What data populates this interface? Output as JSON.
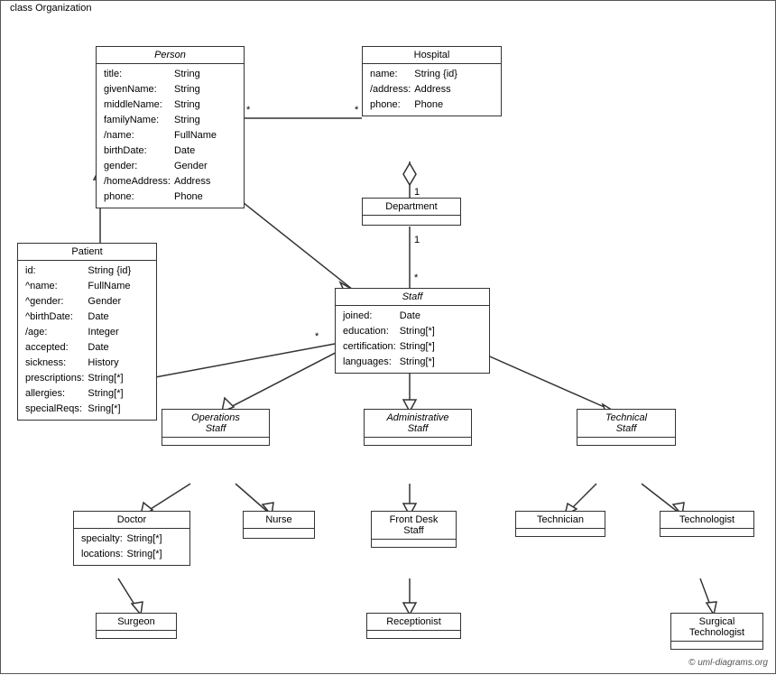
{
  "diagram": {
    "title": "class Organization",
    "copyright": "© uml-diagrams.org",
    "classes": {
      "person": {
        "name": "Person",
        "italic": true,
        "fields": [
          [
            "title:",
            "String"
          ],
          [
            "givenName:",
            "String"
          ],
          [
            "middleName:",
            "String"
          ],
          [
            "familyName:",
            "String"
          ],
          [
            "/name:",
            "FullName"
          ],
          [
            "birthDate:",
            "Date"
          ],
          [
            "gender:",
            "Gender"
          ],
          [
            "/homeAddress:",
            "Address"
          ],
          [
            "phone:",
            "Phone"
          ]
        ]
      },
      "hospital": {
        "name": "Hospital",
        "italic": false,
        "fields": [
          [
            "name:",
            "String {id}"
          ],
          [
            "/address:",
            "Address"
          ],
          [
            "phone:",
            "Phone"
          ]
        ]
      },
      "patient": {
        "name": "Patient",
        "italic": false,
        "fields": [
          [
            "id:",
            "String {id}"
          ],
          [
            "^name:",
            "FullName"
          ],
          [
            "^gender:",
            "Gender"
          ],
          [
            "^birthDate:",
            "Date"
          ],
          [
            "/age:",
            "Integer"
          ],
          [
            "accepted:",
            "Date"
          ],
          [
            "sickness:",
            "History"
          ],
          [
            "prescriptions:",
            "String[*]"
          ],
          [
            "allergies:",
            "String[*]"
          ],
          [
            "specialReqs:",
            "Sring[*]"
          ]
        ]
      },
      "department": {
        "name": "Department",
        "italic": false,
        "fields": []
      },
      "staff": {
        "name": "Staff",
        "italic": true,
        "fields": [
          [
            "joined:",
            "Date"
          ],
          [
            "education:",
            "String[*]"
          ],
          [
            "certification:",
            "String[*]"
          ],
          [
            "languages:",
            "String[*]"
          ]
        ]
      },
      "operations_staff": {
        "name": "Operations\nStaff",
        "italic": true,
        "fields": []
      },
      "administrative_staff": {
        "name": "Administrative\nStaff",
        "italic": true,
        "fields": []
      },
      "technical_staff": {
        "name": "Technical\nStaff",
        "italic": true,
        "fields": []
      },
      "doctor": {
        "name": "Doctor",
        "italic": false,
        "fields": [
          [
            "specialty:",
            "String[*]"
          ],
          [
            "locations:",
            "String[*]"
          ]
        ]
      },
      "nurse": {
        "name": "Nurse",
        "italic": false,
        "fields": []
      },
      "front_desk_staff": {
        "name": "Front Desk\nStaff",
        "italic": false,
        "fields": []
      },
      "technician": {
        "name": "Technician",
        "italic": false,
        "fields": []
      },
      "technologist": {
        "name": "Technologist",
        "italic": false,
        "fields": []
      },
      "surgeon": {
        "name": "Surgeon",
        "italic": false,
        "fields": []
      },
      "receptionist": {
        "name": "Receptionist",
        "italic": false,
        "fields": []
      },
      "surgical_technologist": {
        "name": "Surgical\nTechnologist",
        "italic": false,
        "fields": []
      }
    }
  }
}
